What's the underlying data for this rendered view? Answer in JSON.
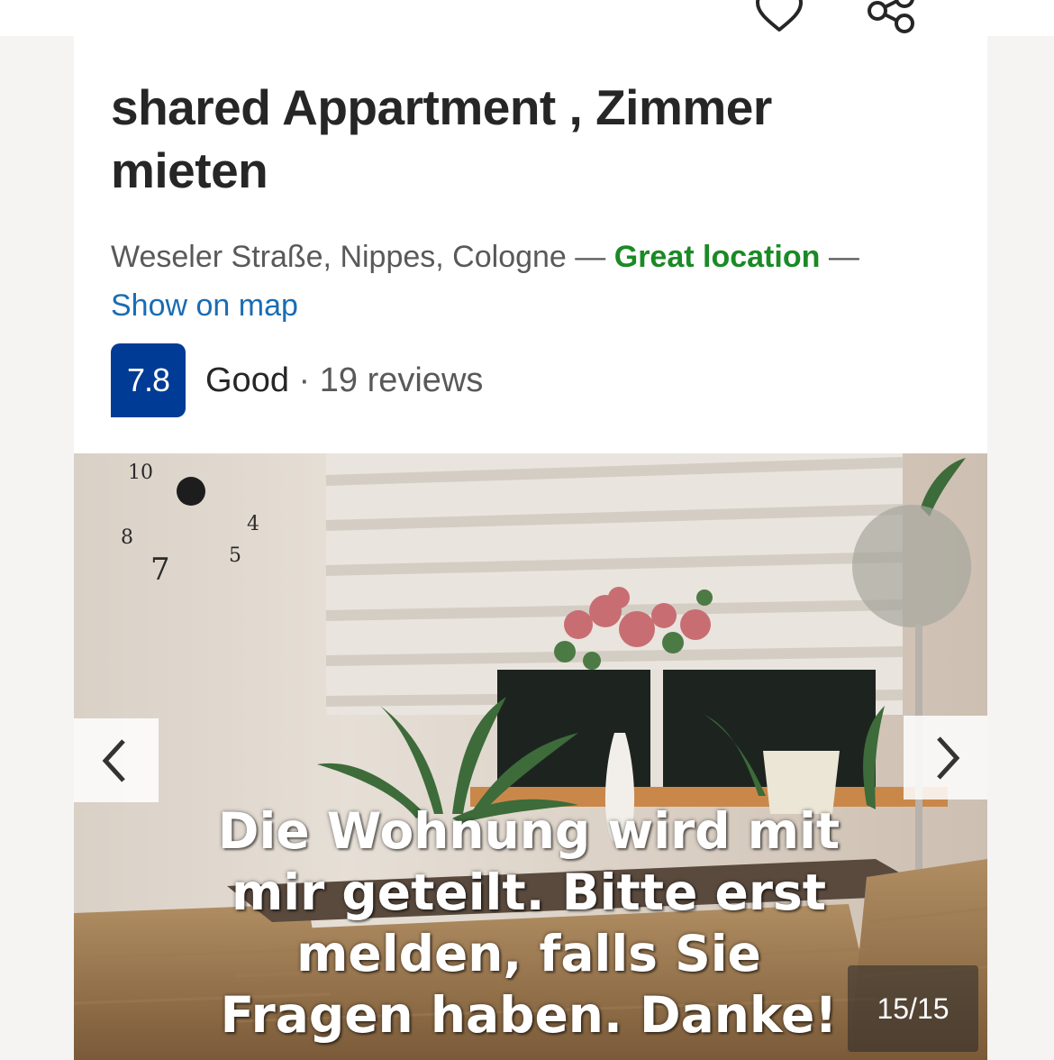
{
  "header": {
    "favorite_icon": "heart-outline-icon",
    "share_icon": "share-nodes-icon"
  },
  "property": {
    "title": "shared Appartment , Zimmer mieten",
    "address": "Weseler Straße, Nippes, Cologne",
    "separator": "—",
    "location_badge": "Great location",
    "map_link": "Show on map"
  },
  "rating": {
    "score": "7.8",
    "label": "Good",
    "separator": "·",
    "reviews": "19 reviews"
  },
  "gallery": {
    "caption": "Die Wohnung wird mit mir geteilt. Bitte erst melden, falls Sie Fragen haben. Danke!",
    "counter": "15/15",
    "prev_icon": "chevron-left-icon",
    "next_icon": "chevron-right-icon"
  },
  "colors": {
    "score_badge": "#003b95",
    "great_location": "#1a8a25",
    "link": "#1a6cb3",
    "title": "#262626"
  }
}
